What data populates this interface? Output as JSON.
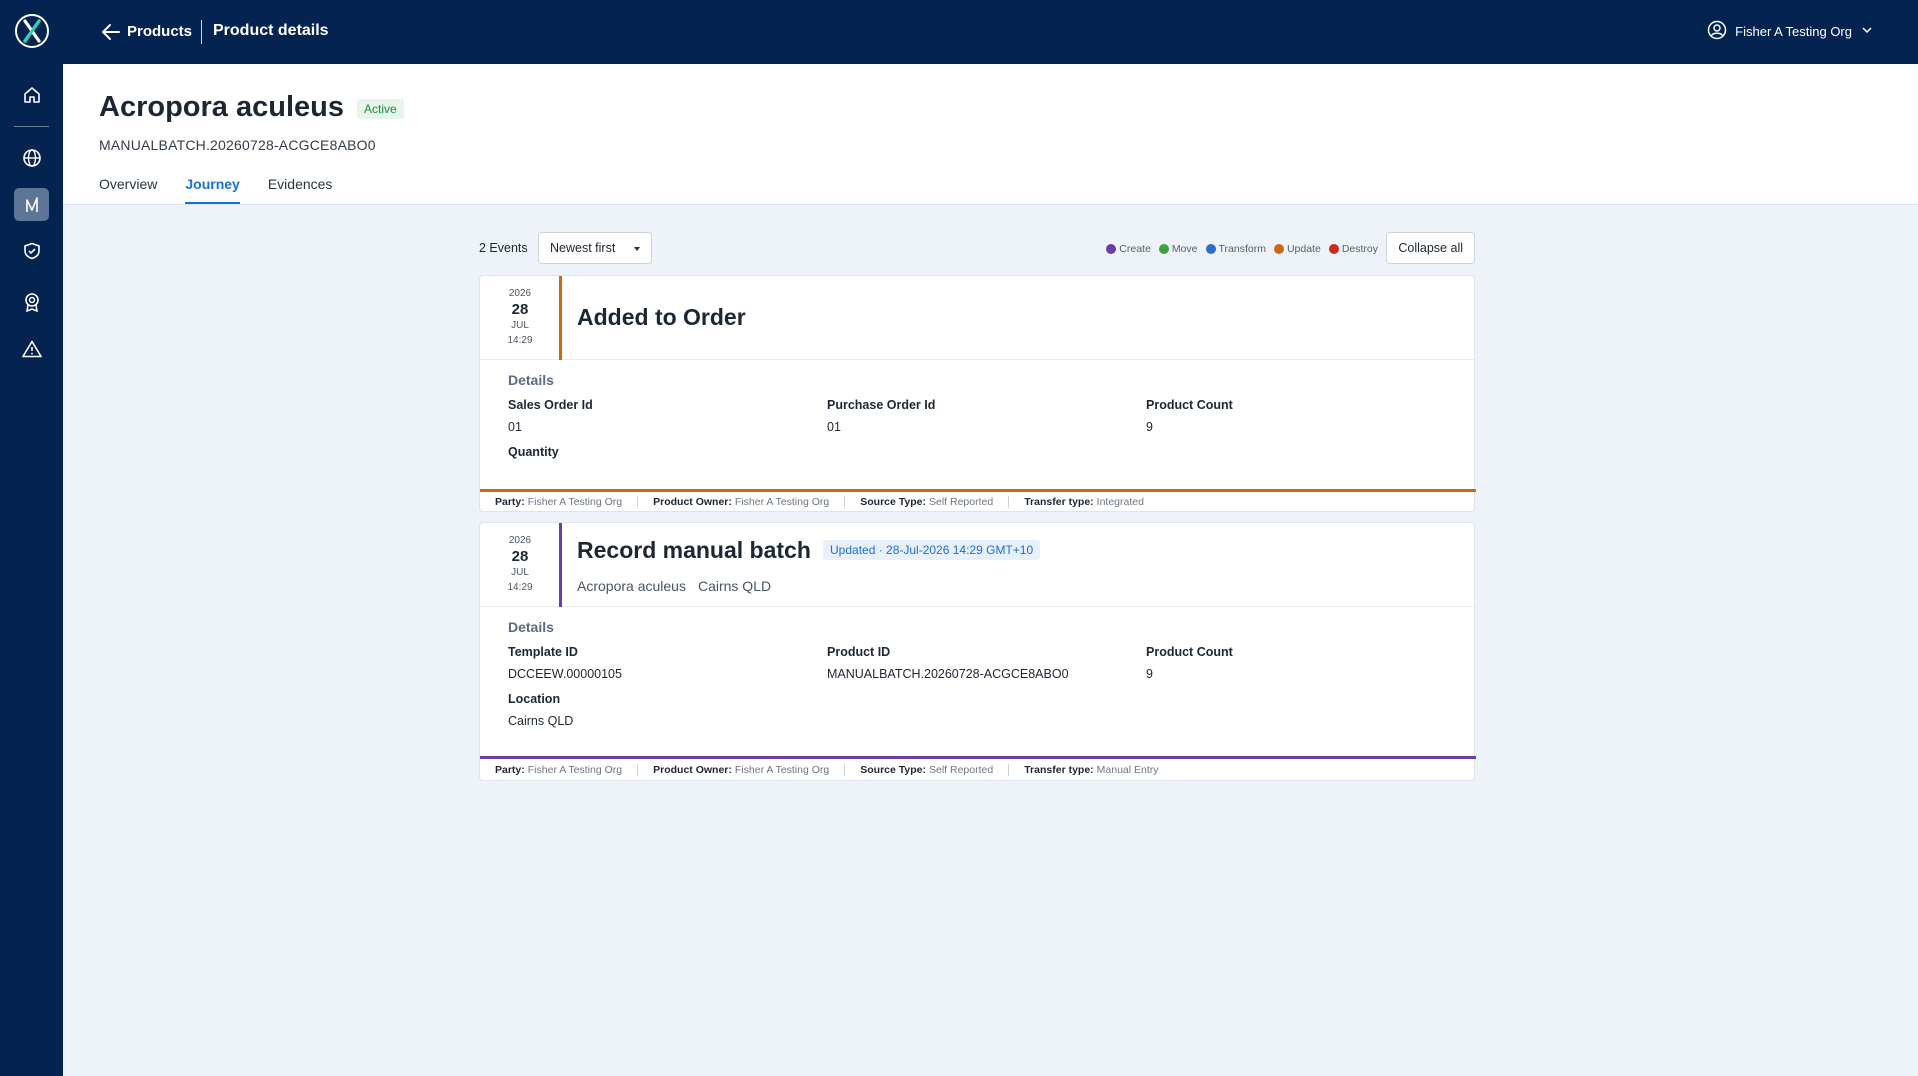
{
  "nav": {
    "breadcrumb_back": "Products",
    "page_title": "Product details",
    "user": "Fisher A Testing Org"
  },
  "product": {
    "name": "Acropora aculeus",
    "status": "Active",
    "batch_id": "MANUALBATCH.20260728-ACGCE8ABO0"
  },
  "tabs": [
    {
      "label": "Overview",
      "active": false
    },
    {
      "label": "Journey",
      "active": true
    },
    {
      "label": "Evidences",
      "active": false
    }
  ],
  "toolbar": {
    "event_count": "2 Events",
    "sort": "Newest first",
    "collapse": "Collapse all"
  },
  "legend": [
    {
      "label": "Create",
      "color": "#6b3ea6"
    },
    {
      "label": "Move",
      "color": "#3fa33d"
    },
    {
      "label": "Transform",
      "color": "#2d6dc4"
    },
    {
      "label": "Update",
      "color": "#c96b16"
    },
    {
      "label": "Destroy",
      "color": "#d0281d"
    }
  ],
  "events": [
    {
      "year": "2026",
      "day": "28",
      "month": "JUL",
      "time": "14:29",
      "title": "Added to Order",
      "color": "#c96b16",
      "details_heading": "Details",
      "fields": [
        {
          "label": "Sales Order Id",
          "value": "01"
        },
        {
          "label": "Purchase Order Id",
          "value": "01"
        },
        {
          "label": "Product Count",
          "value": "9"
        },
        {
          "label": "Quantity",
          "value": ""
        }
      ],
      "footer": {
        "party_label": "Party:",
        "party": "Fisher A Testing Org",
        "owner_label": "Product Owner:",
        "owner": "Fisher A Testing Org",
        "source_label": "Source Type:",
        "source": "Self Reported",
        "transfer_label": "Transfer type:",
        "transfer": "Integrated"
      }
    },
    {
      "year": "2026",
      "day": "28",
      "month": "JUL",
      "time": "14:29",
      "title": "Record manual batch",
      "updated": "Updated · 28-Jul-2026 14:29 GMT+10",
      "sub_product": "Acropora aculeus",
      "sub_location": "Cairns QLD",
      "color": "#6b3ea6",
      "details_heading": "Details",
      "fields": [
        {
          "label": "Template ID",
          "value": "DCCEEW.00000105"
        },
        {
          "label": "Product ID",
          "value": "MANUALBATCH.20260728-ACGCE8ABO0"
        },
        {
          "label": "Product Count",
          "value": "9"
        },
        {
          "label": "Location",
          "value": "Cairns QLD"
        }
      ],
      "footer": {
        "party_label": "Party:",
        "party": "Fisher A Testing Org",
        "owner_label": "Product Owner:",
        "owner": "Fisher A Testing Org",
        "source_label": "Source Type:",
        "source": "Self Reported",
        "transfer_label": "Transfer type:",
        "transfer": "Manual Entry"
      }
    }
  ]
}
